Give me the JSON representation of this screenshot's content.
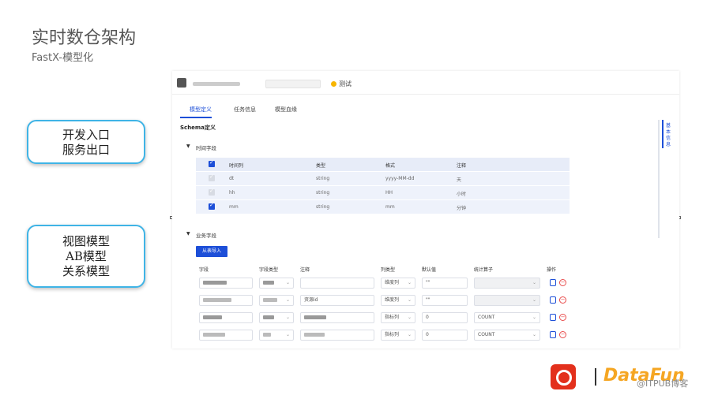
{
  "slide": {
    "title": "实时数仓架构",
    "subtitle": "FastX-模型化"
  },
  "callouts": [
    {
      "lines": [
        "开发入口",
        "服务出口"
      ]
    },
    {
      "lines": [
        "视图模型",
        "AB模型",
        "关系模型"
      ]
    }
  ],
  "app": {
    "env_label": "测试",
    "tabs": [
      "模型定义",
      "任务信息",
      "模型血缘"
    ],
    "active_tab": "模型定义",
    "schema_title": "Schema定义",
    "time_section": {
      "title": "时间字段",
      "columns": [
        "时间列",
        "类型",
        "格式",
        "注释"
      ],
      "rows": [
        {
          "name": "dt",
          "type": "string",
          "format": "yyyy-MM-dd",
          "comment": "天",
          "checked": true,
          "disabled": true
        },
        {
          "name": "hh",
          "type": "string",
          "format": "HH",
          "comment": "小时",
          "checked": true,
          "disabled": true
        },
        {
          "name": "mm",
          "type": "string",
          "format": "mm",
          "comment": "分钟",
          "checked": true,
          "disabled": false
        }
      ]
    },
    "biz_section": {
      "title": "业务字段",
      "import_button": "从表导入",
      "columns": [
        "字段",
        "字段类型",
        "注释",
        "列类型",
        "默认值",
        "统计算子",
        "操作"
      ],
      "rows": [
        {
          "comment": "",
          "col_type": "维度列",
          "default": "\"\"",
          "agg": ""
        },
        {
          "comment": "资源id",
          "col_type": "维度列",
          "default": "\"\"",
          "agg": ""
        },
        {
          "comment": "",
          "col_type": "指标列",
          "default": "0",
          "agg": "COUNT"
        },
        {
          "comment": "",
          "col_type": "指标列",
          "default": "0",
          "agg": "COUNT"
        }
      ]
    },
    "side_panel": "基本信息"
  },
  "branding": {
    "logo_text": "DataFun",
    "watermark": "@ITPUB博客"
  }
}
